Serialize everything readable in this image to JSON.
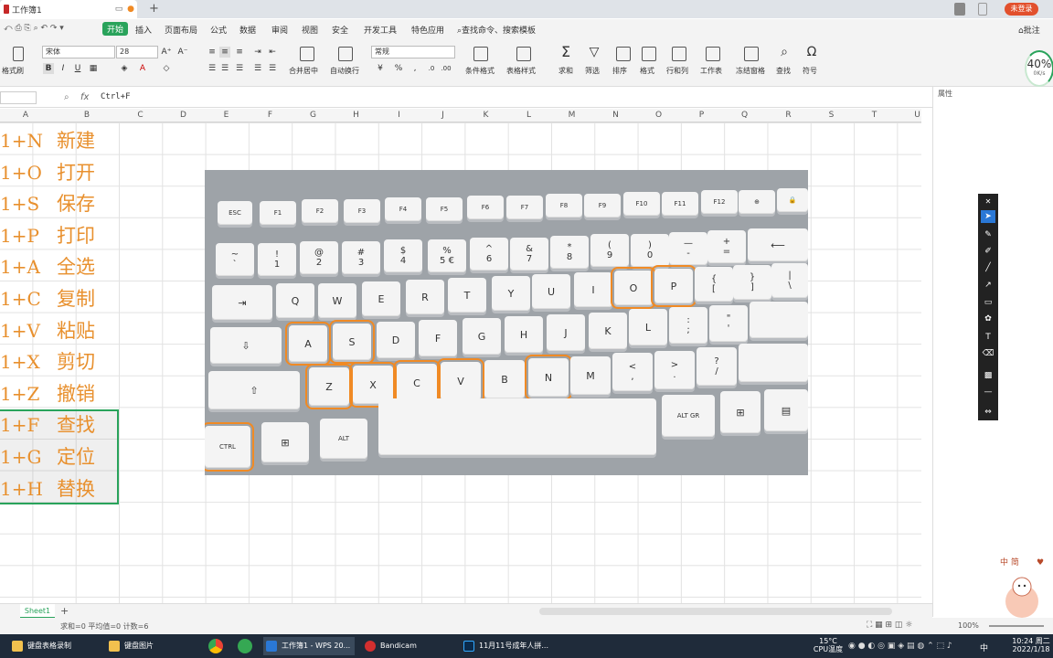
{
  "window": {
    "title": "工作簿1",
    "login": "未登录"
  },
  "ribbon": {
    "tabs": [
      "开始",
      "插入",
      "页面布局",
      "公式",
      "数据",
      "审阅",
      "视图",
      "安全",
      "开发工具",
      "特色应用"
    ],
    "search": "查找命令、搜索模板",
    "comment": "批注"
  },
  "toolbar": {
    "format_painter": "格式刷",
    "font": "宋体",
    "size": "28",
    "number_format": "常规",
    "merge": "合并居中",
    "wrap": "自动换行",
    "cond": "条件格式",
    "table_style": "表格样式",
    "sum": "求和",
    "filter": "筛选",
    "sort": "排序",
    "format": "格式",
    "rowcol": "行和列",
    "sheet": "工作表",
    "freeze": "冻结窗格",
    "find": "查找",
    "symbol": "符号"
  },
  "speed": {
    "percent": "40%",
    "rate": "0K/s"
  },
  "formula": {
    "fx": "fx",
    "content": "Ctrl+F",
    "props": "属性"
  },
  "columns": [
    "A",
    "B",
    "C",
    "D",
    "E",
    "F",
    "G",
    "H",
    "I",
    "J",
    "K",
    "L",
    "M",
    "N",
    "O",
    "P",
    "Q",
    "R",
    "S",
    "T",
    "U"
  ],
  "rows": [
    {
      "a": "1+N",
      "b": "新建"
    },
    {
      "a": "1+O",
      "b": "打开"
    },
    {
      "a": "1+S",
      "b": "保存"
    },
    {
      "a": "1+P",
      "b": "打印"
    },
    {
      "a": "1+A",
      "b": "全选"
    },
    {
      "a": "1+C",
      "b": "复制"
    },
    {
      "a": "1+V",
      "b": "粘贴"
    },
    {
      "a": "1+X",
      "b": "剪切"
    },
    {
      "a": "1+Z",
      "b": "撤销"
    },
    {
      "a": "1+F",
      "b": "查找"
    },
    {
      "a": "1+G",
      "b": "定位"
    },
    {
      "a": "1+H",
      "b": "替换"
    }
  ],
  "sheet": {
    "name": "Sheet1",
    "add": "+"
  },
  "status": {
    "text": "求和=0  平均值=0  计数=6",
    "zoom": "100%"
  },
  "taskbar": {
    "items": [
      "键盘表格录制",
      "键盘图片",
      "工作簿1 - WPS 20...",
      "Bandicam",
      "11月11号成年人拼..."
    ],
    "weather": "15°C",
    "cpu": "CPU温度",
    "ime": "中",
    "time": "10:24 周二",
    "date": "2022/1/18"
  },
  "deco": {
    "text": "中 简"
  },
  "keyboard": {
    "highlight_color": "#f08a24",
    "highlighted": [
      "O",
      "P",
      "A",
      "S",
      "Z",
      "X",
      "C",
      "V",
      "N",
      "CTRL"
    ]
  }
}
